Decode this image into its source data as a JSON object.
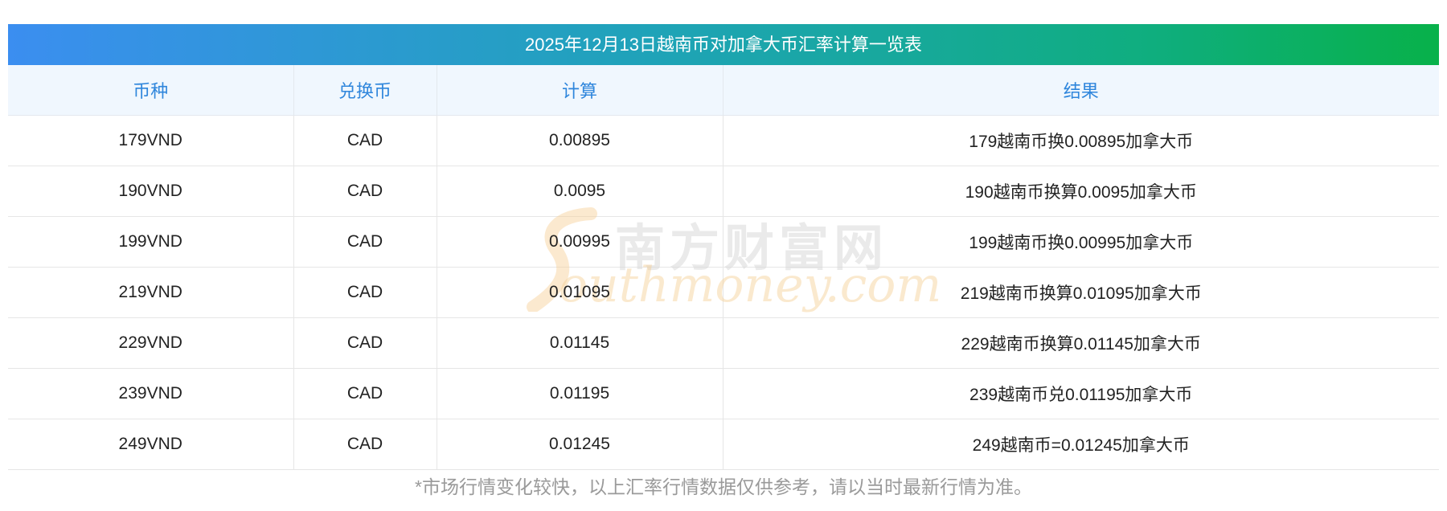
{
  "title": "2025年12月13日越南币对加拿大币汇率计算一览表",
  "columns": [
    "币种",
    "兑换币",
    "计算",
    "结果"
  ],
  "rows": [
    {
      "currency": "179VND",
      "target": "CAD",
      "calc": "0.00895",
      "result": "179越南币换0.00895加拿大币"
    },
    {
      "currency": "190VND",
      "target": "CAD",
      "calc": "0.0095",
      "result": "190越南币换算0.0095加拿大币"
    },
    {
      "currency": "199VND",
      "target": "CAD",
      "calc": "0.00995",
      "result": "199越南币换0.00995加拿大币"
    },
    {
      "currency": "219VND",
      "target": "CAD",
      "calc": "0.01095",
      "result": "219越南币换算0.01095加拿大币"
    },
    {
      "currency": "229VND",
      "target": "CAD",
      "calc": "0.01145",
      "result": "229越南币换算0.01145加拿大币"
    },
    {
      "currency": "239VND",
      "target": "CAD",
      "calc": "0.01195",
      "result": "239越南币兑0.01195加拿大币"
    },
    {
      "currency": "249VND",
      "target": "CAD",
      "calc": "0.01245",
      "result": "249越南币=0.01245加拿大币"
    }
  ],
  "watermark": {
    "cn": "南方财富网",
    "en": "outhmoney.com"
  },
  "disclaimer": "*市场行情变化较快，以上汇率行情数据仅供参考，请以当时最新行情为准。",
  "colors": {
    "header_gradient_start": "#3b8ef0",
    "header_gradient_end": "#08b14a",
    "column_header_text": "#2f86dc",
    "column_header_bg": "#f0f7fe"
  }
}
